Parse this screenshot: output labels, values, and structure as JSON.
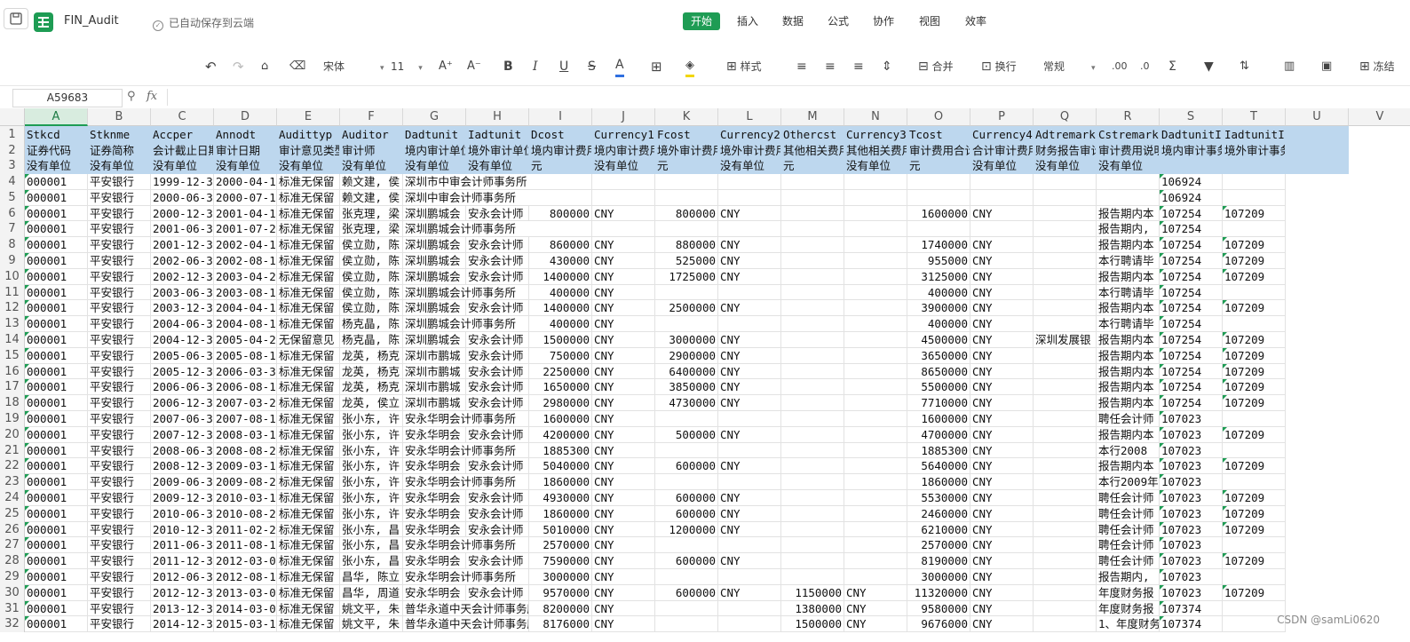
{
  "title_bar": {
    "doc_name": "FIN_Audit",
    "autosave_text": "已自动保存到云端"
  },
  "menu": {
    "items": [
      "开始",
      "插入",
      "数据",
      "公式",
      "协作",
      "视图",
      "效率"
    ],
    "active": "开始"
  },
  "toolbar": {
    "font_name": "宋体",
    "font_size": "11",
    "style_label": "样式",
    "merge_label": "合并",
    "wrap_label": "换行",
    "format_label": "常规",
    "freeze_label": "冻结"
  },
  "formula_bar": {
    "name_box": "A59683",
    "fx_label": "fx",
    "formula": ""
  },
  "columns": [
    "A",
    "B",
    "C",
    "D",
    "E",
    "F",
    "G",
    "H",
    "I",
    "J",
    "K",
    "L",
    "M",
    "N",
    "O",
    "P",
    "Q",
    "R",
    "S",
    "T",
    "U",
    "V"
  ],
  "selected_column": "A",
  "rows": [
    {
      "n": "1",
      "c": [
        "Stkcd",
        "Stknme",
        "Accper",
        "Annodt",
        "Audittyp",
        "Auditor",
        "Dadtunit",
        "Iadtunit",
        "Dcost",
        "Currency1",
        "Fcost",
        "Currency2",
        "Othercst",
        "Currency3",
        "Tcost",
        "Currency4",
        "Adtremark",
        "Cstremark",
        "DadtunitID",
        "IadtunitID"
      ]
    },
    {
      "n": "2",
      "c": [
        "证券代码",
        "证券简称",
        "会计截止日期",
        "审计日期",
        "审计意见类型",
        "审计师",
        "境内审计单位",
        "境外审计单位",
        "境内审计费用",
        "境内审计费用币种",
        "境外审计费用",
        "境外审计费用币种",
        "其他相关费用",
        "其他相关费用币种",
        "审计费用合计",
        "合计审计费用币种",
        "财务报告审计",
        "审计费用说明",
        "境内审计事务所ID",
        "境外审计事务所ID"
      ]
    },
    {
      "n": "3",
      "c": [
        "没有单位",
        "没有单位",
        "没有单位",
        "没有单位",
        "没有单位",
        "没有单位",
        "没有单位",
        "没有单位",
        "元",
        "没有单位",
        "元",
        "没有单位",
        "元",
        "没有单位",
        "元",
        "没有单位",
        "没有单位",
        "没有单位",
        "",
        ""
      ]
    },
    {
      "n": "4",
      "c": [
        "000001",
        "平安银行",
        "1999-12-31",
        "2000-04-1",
        "标准无保留",
        "赖文建, 侯",
        "深圳市中审会计师事务所",
        "",
        "",
        "",
        "",
        "",
        "",
        "",
        "",
        "",
        "",
        "",
        "106924",
        ""
      ]
    },
    {
      "n": "5",
      "c": [
        "000001",
        "平安银行",
        "2000-06-30",
        "2000-07-1",
        "标准无保留",
        "赖文建, 侯",
        "深圳中审会计师事务所",
        "",
        "",
        "",
        "",
        "",
        "",
        "",
        "",
        "",
        "",
        "",
        "106924",
        ""
      ]
    },
    {
      "n": "6",
      "c": [
        "000001",
        "平安银行",
        "2000-12-31",
        "2001-04-1",
        "标准无保留",
        "张克理, 梁",
        "深圳鹏城会",
        "安永会计师",
        "800000",
        "CNY",
        "800000",
        "CNY",
        "",
        "",
        "1600000",
        "CNY",
        "",
        "报告期内本",
        "107254",
        "107209"
      ]
    },
    {
      "n": "7",
      "c": [
        "000001",
        "平安银行",
        "2001-06-30",
        "2001-07-2",
        "标准无保留",
        "张克理, 梁",
        "深圳鹏城会计师事务所",
        "",
        "",
        "",
        "",
        "",
        "",
        "",
        "",
        "",
        "",
        "报告期内,",
        "107254",
        ""
      ]
    },
    {
      "n": "8",
      "c": [
        "000001",
        "平安银行",
        "2001-12-31",
        "2002-04-1",
        "标准无保留",
        "侯立勋, 陈",
        "深圳鹏城会",
        "安永会计师",
        "860000",
        "CNY",
        "880000",
        "CNY",
        "",
        "",
        "1740000",
        "CNY",
        "",
        "报告期内本",
        "107254",
        "107209"
      ]
    },
    {
      "n": "9",
      "c": [
        "000001",
        "平安银行",
        "2002-06-30",
        "2002-08-1",
        "标准无保留",
        "侯立勋, 陈",
        "深圳鹏城会",
        "安永会计师",
        "430000",
        "CNY",
        "525000",
        "CNY",
        "",
        "",
        "955000",
        "CNY",
        "",
        "本行聘请毕",
        "107254",
        "107209"
      ]
    },
    {
      "n": "10",
      "c": [
        "000001",
        "平安银行",
        "2002-12-31",
        "2003-04-2",
        "标准无保留",
        "侯立勋, 陈",
        "深圳鹏城会",
        "安永会计师",
        "1400000",
        "CNY",
        "1725000",
        "CNY",
        "",
        "",
        "3125000",
        "CNY",
        "",
        "报告期内本",
        "107254",
        "107209"
      ]
    },
    {
      "n": "11",
      "c": [
        "000001",
        "平安银行",
        "2003-06-30",
        "2003-08-1",
        "标准无保留",
        "侯立勋, 陈",
        "深圳鹏城会计师事务所",
        "",
        "400000",
        "CNY",
        "",
        "",
        "",
        "",
        "400000",
        "CNY",
        "",
        "本行聘请毕",
        "107254",
        ""
      ]
    },
    {
      "n": "12",
      "c": [
        "000001",
        "平安银行",
        "2003-12-31",
        "2004-04-1",
        "标准无保留",
        "侯立勋, 陈",
        "深圳鹏城会",
        "安永会计师",
        "1400000",
        "CNY",
        "2500000",
        "CNY",
        "",
        "",
        "3900000",
        "CNY",
        "",
        "报告期内本",
        "107254",
        "107209"
      ]
    },
    {
      "n": "13",
      "c": [
        "000001",
        "平安银行",
        "2004-06-30",
        "2004-08-1",
        "标准无保留",
        "杨克晶, 陈",
        "深圳鹏城会计师事务所",
        "",
        "400000",
        "CNY",
        "",
        "",
        "",
        "",
        "400000",
        "CNY",
        "",
        "本行聘请毕",
        "107254",
        ""
      ]
    },
    {
      "n": "14",
      "c": [
        "000001",
        "平安银行",
        "2004-12-31",
        "2005-04-2",
        "无保留意见",
        "杨克晶, 陈",
        "深圳鹏城会",
        "安永会计师",
        "1500000",
        "CNY",
        "3000000",
        "CNY",
        "",
        "",
        "4500000",
        "CNY",
        "深圳发展银",
        "报告期内本",
        "107254",
        "107209"
      ]
    },
    {
      "n": "15",
      "c": [
        "000001",
        "平安银行",
        "2005-06-30",
        "2005-08-1",
        "标准无保留",
        "龙英, 杨克",
        "深圳市鹏城",
        "安永会计师",
        "750000",
        "CNY",
        "2900000",
        "CNY",
        "",
        "",
        "3650000",
        "CNY",
        "",
        "报告期内本",
        "107254",
        "107209"
      ]
    },
    {
      "n": "16",
      "c": [
        "000001",
        "平安银行",
        "2005-12-31",
        "2006-03-3",
        "标准无保留",
        "龙英, 杨克",
        "深圳市鹏城",
        "安永会计师",
        "2250000",
        "CNY",
        "6400000",
        "CNY",
        "",
        "",
        "8650000",
        "CNY",
        "",
        "报告期内本",
        "107254",
        "107209"
      ]
    },
    {
      "n": "17",
      "c": [
        "000001",
        "平安银行",
        "2006-06-30",
        "2006-08-1",
        "标准无保留",
        "龙英, 杨克",
        "深圳市鹏城",
        "安永会计师",
        "1650000",
        "CNY",
        "3850000",
        "CNY",
        "",
        "",
        "5500000",
        "CNY",
        "",
        "报告期内本",
        "107254",
        "107209"
      ]
    },
    {
      "n": "18",
      "c": [
        "000001",
        "平安银行",
        "2006-12-31",
        "2007-03-2",
        "标准无保留",
        "龙英, 侯立",
        "深圳市鹏城",
        "安永会计师",
        "2980000",
        "CNY",
        "4730000",
        "CNY",
        "",
        "",
        "7710000",
        "CNY",
        "",
        "报告期内本",
        "107254",
        "107209"
      ]
    },
    {
      "n": "19",
      "c": [
        "000001",
        "平安银行",
        "2007-06-30",
        "2007-08-1",
        "标准无保留",
        "张小东, 许",
        "安永华明会计师事务所",
        "",
        "1600000",
        "CNY",
        "",
        "",
        "",
        "",
        "1600000",
        "CNY",
        "",
        "聘任会计师",
        "107023",
        ""
      ]
    },
    {
      "n": "20",
      "c": [
        "000001",
        "平安银行",
        "2007-12-31",
        "2008-03-1",
        "标准无保留",
        "张小东, 许",
        "安永华明会",
        "安永会计师",
        "4200000",
        "CNY",
        "500000",
        "CNY",
        "",
        "",
        "4700000",
        "CNY",
        "",
        "报告期内本",
        "107023",
        "107209"
      ]
    },
    {
      "n": "21",
      "c": [
        "000001",
        "平安银行",
        "2008-06-30",
        "2008-08-2",
        "标准无保留",
        "张小东, 许",
        "安永华明会计师事务所",
        "",
        "1885300",
        "CNY",
        "",
        "",
        "",
        "",
        "1885300",
        "CNY",
        "",
        "本行2008",
        "107023",
        ""
      ]
    },
    {
      "n": "22",
      "c": [
        "000001",
        "平安银行",
        "2008-12-31",
        "2009-03-1",
        "标准无保留",
        "张小东, 许",
        "安永华明会",
        "安永会计师",
        "5040000",
        "CNY",
        "600000",
        "CNY",
        "",
        "",
        "5640000",
        "CNY",
        "",
        "报告期内本",
        "107023",
        "107209"
      ]
    },
    {
      "n": "23",
      "c": [
        "000001",
        "平安银行",
        "2009-06-30",
        "2009-08-2",
        "标准无保留",
        "张小东, 许",
        "安永华明会计师事务所",
        "",
        "1860000",
        "CNY",
        "",
        "",
        "",
        "",
        "1860000",
        "CNY",
        "",
        "本行2009年",
        "107023",
        ""
      ]
    },
    {
      "n": "24",
      "c": [
        "000001",
        "平安银行",
        "2009-12-31",
        "2010-03-1",
        "标准无保留",
        "张小东, 许",
        "安永华明会",
        "安永会计师",
        "4930000",
        "CNY",
        "600000",
        "CNY",
        "",
        "",
        "5530000",
        "CNY",
        "",
        "聘任会计师",
        "107023",
        "107209"
      ]
    },
    {
      "n": "25",
      "c": [
        "000001",
        "平安银行",
        "2010-06-30",
        "2010-08-2",
        "标准无保留",
        "张小东, 许",
        "安永华明会",
        "安永会计师",
        "1860000",
        "CNY",
        "600000",
        "CNY",
        "",
        "",
        "2460000",
        "CNY",
        "",
        "聘任会计师",
        "107023",
        "107209"
      ]
    },
    {
      "n": "26",
      "c": [
        "000001",
        "平安银行",
        "2010-12-31",
        "2011-02-2",
        "标准无保留",
        "张小东, 昌",
        "安永华明会",
        "安永会计师",
        "5010000",
        "CNY",
        "1200000",
        "CNY",
        "",
        "",
        "6210000",
        "CNY",
        "",
        "聘任会计师",
        "107023",
        "107209"
      ]
    },
    {
      "n": "27",
      "c": [
        "000001",
        "平安银行",
        "2011-06-30",
        "2011-08-1",
        "标准无保留",
        "张小东, 昌",
        "安永华明会计师事务所",
        "",
        "2570000",
        "CNY",
        "",
        "",
        "",
        "",
        "2570000",
        "CNY",
        "",
        "聘任会计师",
        "107023",
        ""
      ]
    },
    {
      "n": "28",
      "c": [
        "000001",
        "平安银行",
        "2011-12-31",
        "2012-03-0",
        "标准无保留",
        "张小东, 昌",
        "安永华明会",
        "安永会计师",
        "7590000",
        "CNY",
        "600000",
        "CNY",
        "",
        "",
        "8190000",
        "CNY",
        "",
        "聘任会计师",
        "107023",
        "107209"
      ]
    },
    {
      "n": "29",
      "c": [
        "000001",
        "平安银行",
        "2012-06-30",
        "2012-08-1",
        "标准无保留",
        "昌华, 陈立",
        "安永华明会计师事务所",
        "",
        "3000000",
        "CNY",
        "",
        "",
        "",
        "",
        "3000000",
        "CNY",
        "",
        "报告期内,",
        "107023",
        ""
      ]
    },
    {
      "n": "30",
      "c": [
        "000001",
        "平安银行",
        "2012-12-31",
        "2013-03-0",
        "标准无保留",
        "昌华, 周道",
        "安永华明会",
        "安永会计师",
        "9570000",
        "CNY",
        "600000",
        "CNY",
        "1150000",
        "CNY",
        "11320000",
        "CNY",
        "",
        "年度财务报",
        "107023",
        "107209"
      ]
    },
    {
      "n": "31",
      "c": [
        "000001",
        "平安银行",
        "2013-12-31",
        "2014-03-0",
        "标准无保留",
        "姚文平, 朱",
        "普华永道中天会计师事务所",
        "",
        "8200000",
        "CNY",
        "",
        "",
        "1380000",
        "CNY",
        "9580000",
        "CNY",
        "",
        "年度财务报",
        "107374",
        ""
      ]
    },
    {
      "n": "32",
      "c": [
        "000001",
        "平安银行",
        "2014-12-31",
        "2015-03-1",
        "标准无保留",
        "姚文平, 朱",
        "普华永道中天会计师事务所",
        "",
        "8176000",
        "CNY",
        "",
        "",
        "1500000",
        "CNY",
        "9676000",
        "CNY",
        "",
        "1、年度财务",
        "107374",
        ""
      ]
    }
  ],
  "watermark": "CSDN @samLi0620"
}
